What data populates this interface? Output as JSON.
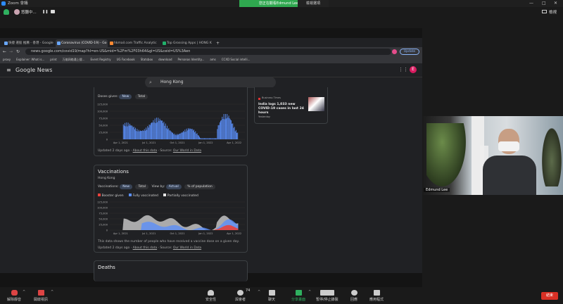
{
  "window": {
    "title": "Zoom 會議",
    "minimize": "—",
    "maximize": "□",
    "close": "✕"
  },
  "top": {
    "participant_label": "悠聽中...",
    "banner": "您正在觀看Edmund Lee的畫面",
    "view_options": "檢視選項",
    "view_mode": "檢視"
  },
  "browser": {
    "tabs": [
      {
        "label": "快捷 選股 推薦 - 香港 - Google",
        "color": "#6aa8ff"
      },
      {
        "label": "Coronavirus (COVID-19) - Go",
        "color": "#6aa8ff"
      },
      {
        "label": "hkmail.com Traffic Analytic",
        "color": "#ff8a33"
      },
      {
        "label": "Top Grossing Apps | HONG K",
        "color": "#21b06b"
      }
    ],
    "new_tab": "+",
    "url": "news.google.com/covid19/map?hl=en-US&mid=%2Fm%2F03h64&gl=US&ceid=US%3Aen",
    "update_label": "Update",
    "bookmarks": [
      "proxy",
      "Explainer: What is...",
      "print",
      "万维网络通上搜...",
      "Event Registry",
      "UG Facebook",
      "Statsbox",
      "download",
      "Personas Identity...",
      "ams",
      "CCXD Social intelli..."
    ]
  },
  "gnews": {
    "title": "Google News",
    "search_value": "Hong Kong",
    "avatar": "E"
  },
  "doses_card": {
    "label": "Doses given:",
    "pill_new": "New",
    "pill_total": "Total",
    "yticks": [
      "125,000",
      "100,000",
      "75,000",
      "50,000",
      "25,000",
      "0"
    ],
    "xticks": [
      "Apr 1, 2021",
      "Jul 1, 2021",
      "Oct 1, 2021",
      "Jan 1, 2022",
      "Apr 1, 2022"
    ],
    "updated": "Updated 2 days ago",
    "about": "About this data",
    "source_label": "Source:",
    "source": "Our World in Data"
  },
  "vacc_card": {
    "title": "Vaccinations",
    "location": "Hong Kong",
    "label": "Vaccinations:",
    "pill_new": "New",
    "pill_total": "Total",
    "view_by": "View by:",
    "pill_actual": "Actual",
    "pill_pct": "% of population",
    "legend": [
      "Booster given",
      "Fully vaccinated",
      "Partially vaccinated"
    ],
    "legend_colors": [
      "#e8413c",
      "#5b8ff9",
      "#e6e6e6"
    ],
    "yticks": [
      "125,000",
      "100,000",
      "75,000",
      "50,000",
      "25,000",
      "0"
    ],
    "xticks": [
      "Apr 1, 2021",
      "Jul 1, 2021",
      "Oct 1, 2021",
      "Jan 1, 2022",
      "Apr 1, 2022"
    ],
    "footnote": "This data shows the number of people who have received a vaccine dose on a given day.",
    "updated": "Updated 2 days ago",
    "about": "About this data",
    "source_label": "Source:",
    "source": "Our World in Data"
  },
  "deaths_card": {
    "title": "Deaths"
  },
  "news_card": {
    "source": "Business Times",
    "headline": "India logs 1,033 new COVID-19 cases in last 24 hours",
    "time": "Yesterday"
  },
  "video": {
    "name": "Edmund Lee"
  },
  "toolbar": {
    "mute": "解除靜音",
    "video": "開啟視訊",
    "security": "安全性",
    "participants": "與會者",
    "participants_count": "74",
    "chat": "聊天",
    "share": "分享畫面",
    "pause_share": "暫停/停止錄製",
    "reactions": "回應",
    "apps": "應用程式",
    "end": "結束"
  },
  "chart_data": [
    {
      "type": "bar",
      "title": "Doses given",
      "series": [
        {
          "name": "New",
          "values": []
        }
      ],
      "xlabel": "",
      "ylabel": "",
      "ylim": [
        0,
        125000
      ],
      "categories": [
        "Apr 1, 2021",
        "Jul 1, 2021",
        "Oct 1, 2021",
        "Jan 1, 2022",
        "Apr 1, 2022"
      ]
    },
    {
      "type": "area",
      "title": "Vaccinations",
      "series": [
        {
          "name": "Booster given"
        },
        {
          "name": "Fully vaccinated"
        },
        {
          "name": "Partially vaccinated"
        }
      ],
      "ylim": [
        0,
        125000
      ],
      "categories": [
        "Apr 1, 2021",
        "Jul 1, 2021",
        "Oct 1, 2021",
        "Jan 1, 2022",
        "Apr 1, 2022"
      ]
    }
  ]
}
